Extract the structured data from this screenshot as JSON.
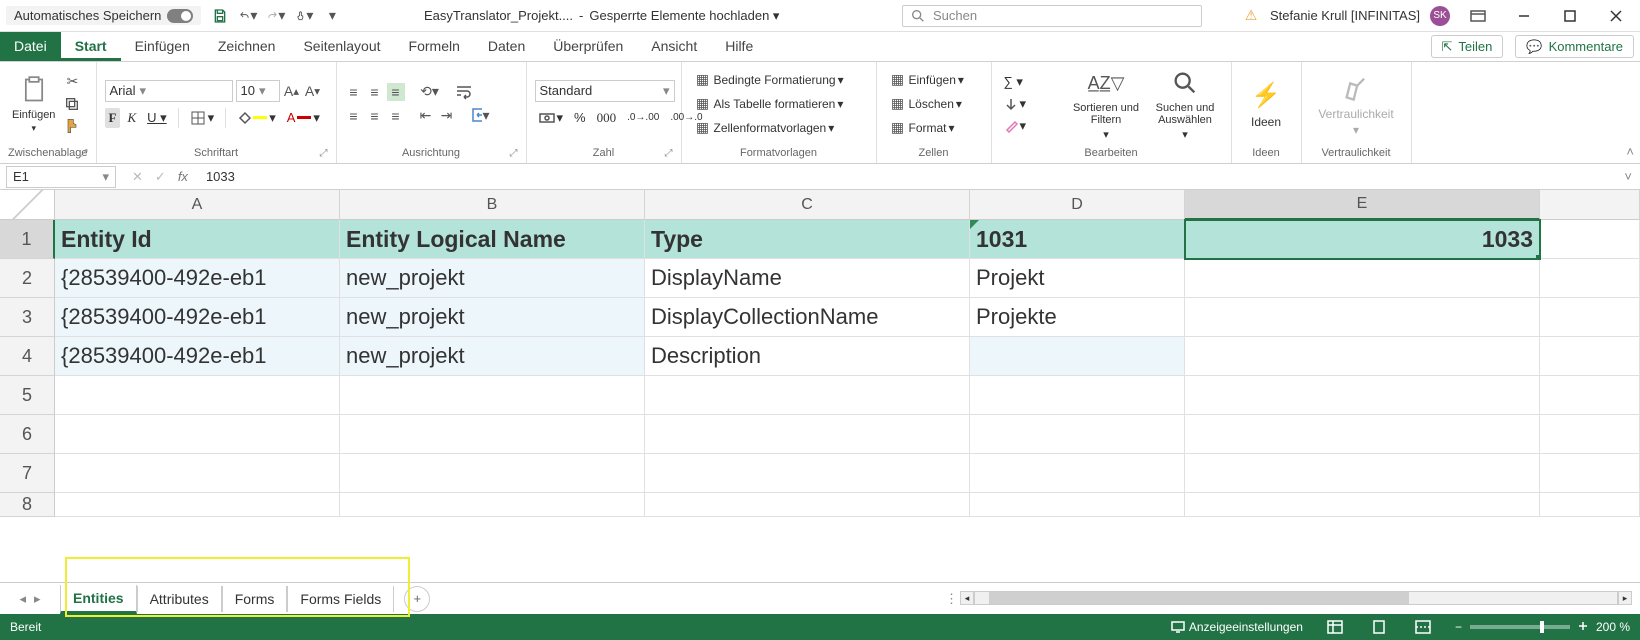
{
  "titlebar": {
    "autosave_label": "Automatisches Speichern",
    "filename": "EasyTranslator_Projekt....",
    "upload_label": "Gesperrte Elemente hochladen",
    "search_placeholder": "Suchen",
    "user_name": "Stefanie Krull [INFINITAS]",
    "user_initials": "SK"
  },
  "tabs": {
    "file": "Datei",
    "items": [
      "Start",
      "Einfügen",
      "Zeichnen",
      "Seitenlayout",
      "Formeln",
      "Daten",
      "Überprüfen",
      "Ansicht",
      "Hilfe"
    ],
    "share": "Teilen",
    "comments": "Kommentare"
  },
  "ribbon": {
    "clipboard": {
      "paste": "Einfügen",
      "label": "Zwischenablage"
    },
    "font": {
      "name": "Arial",
      "size": "10",
      "label": "Schriftart"
    },
    "alignment": {
      "label": "Ausrichtung"
    },
    "number": {
      "format": "Standard",
      "label": "Zahl"
    },
    "styles": {
      "cond": "Bedingte Formatierung",
      "table": "Als Tabelle formatieren",
      "cell": "Zellenformatvorlagen",
      "label": "Formatvorlagen"
    },
    "cells": {
      "insert": "Einfügen",
      "delete": "Löschen",
      "format": "Format",
      "label": "Zellen"
    },
    "editing": {
      "sort": "Sortieren und Filtern",
      "find": "Suchen und Auswählen",
      "label": "Bearbeiten"
    },
    "ideas": {
      "btn": "Ideen",
      "label": "Ideen"
    },
    "sensitivity": {
      "btn": "Vertraulichkeit",
      "label": "Vertraulichkeit"
    }
  },
  "formula_bar": {
    "name": "E1",
    "value": "1033"
  },
  "grid": {
    "columns": [
      "A",
      "B",
      "C",
      "D",
      "E"
    ],
    "header_row": [
      "Entity Id",
      "Entity Logical Name",
      "Type",
      "1031",
      "1033"
    ],
    "rows": [
      {
        "n": "2",
        "cells": [
          "{28539400-492e-eb1",
          "new_projekt",
          "DisplayName",
          "Projekt",
          ""
        ]
      },
      {
        "n": "3",
        "cells": [
          "{28539400-492e-eb1",
          "new_projekt",
          "DisplayCollectionName",
          "Projekte",
          ""
        ]
      },
      {
        "n": "4",
        "cells": [
          "{28539400-492e-eb1",
          "new_projekt",
          "Description",
          "",
          ""
        ]
      }
    ],
    "empty_rows": [
      "5",
      "6",
      "7",
      "8"
    ],
    "selected": "E1"
  },
  "sheets": {
    "items": [
      "Entities",
      "Attributes",
      "Forms",
      "Forms Fields"
    ]
  },
  "status": {
    "ready": "Bereit",
    "display": "Anzeigeeinstellungen",
    "zoom": "200 %"
  }
}
